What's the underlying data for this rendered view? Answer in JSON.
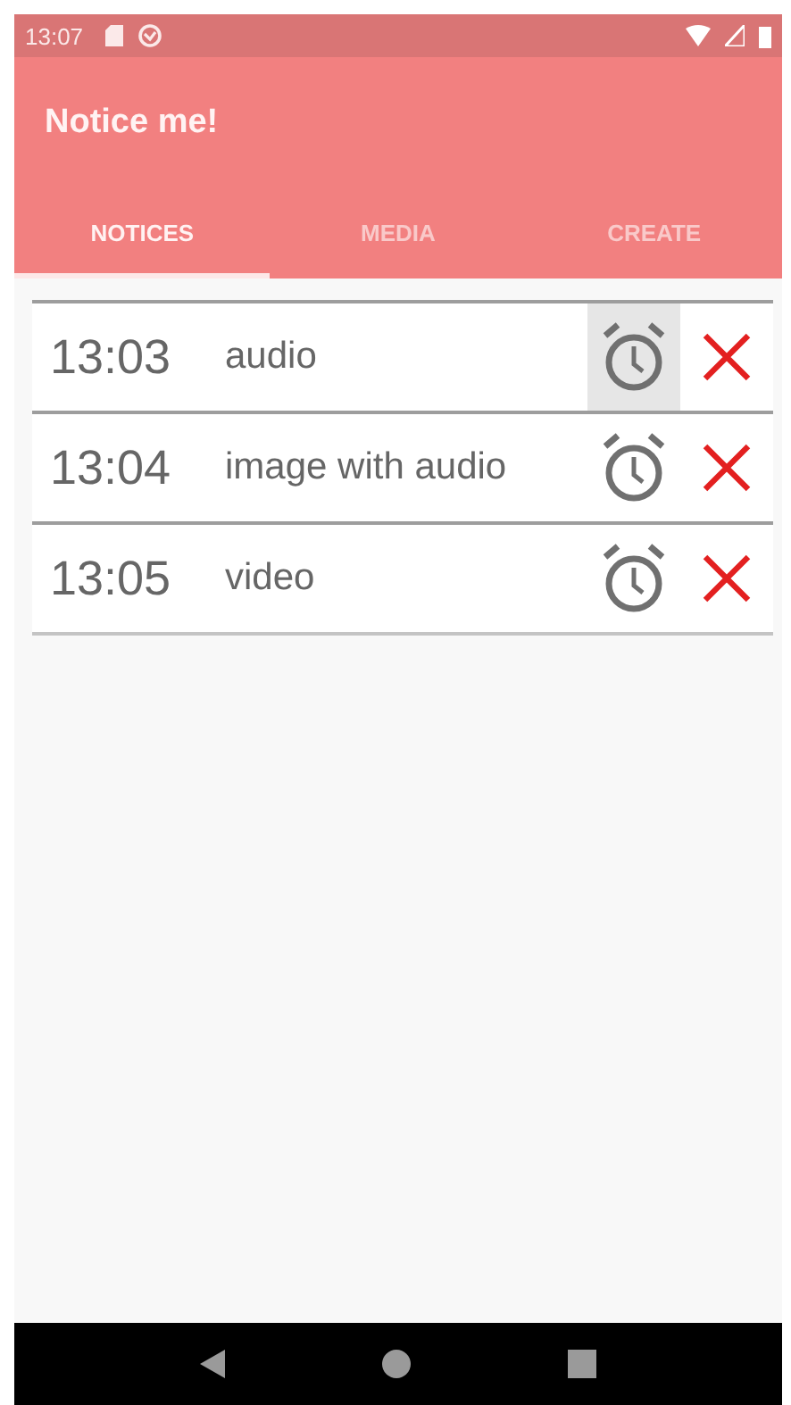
{
  "status_bar": {
    "time": "13:07"
  },
  "app_bar": {
    "title": "Notice me!"
  },
  "tabs": [
    {
      "label": "NOTICES",
      "selected": true
    },
    {
      "label": "MEDIA",
      "selected": false
    },
    {
      "label": "CREATE",
      "selected": false
    }
  ],
  "notices": [
    {
      "time": "13:03",
      "label": "audio",
      "alarm_pressed": true
    },
    {
      "time": "13:04",
      "label": "image with audio",
      "alarm_pressed": false
    },
    {
      "time": "13:05",
      "label": "video",
      "alarm_pressed": false
    }
  ]
}
